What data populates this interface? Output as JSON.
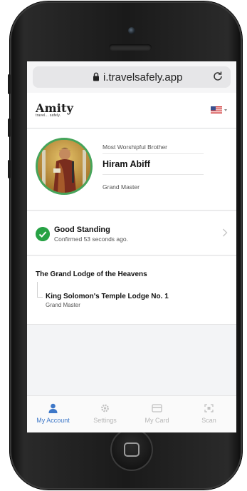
{
  "browser": {
    "url": "i.travelsafely.app"
  },
  "app": {
    "logo_text": "Amity",
    "logo_tagline": "travel... safely."
  },
  "profile": {
    "title": "Most Worshipful Brother",
    "name": "Hiram Abiff",
    "rank": "Grand Master"
  },
  "standing": {
    "status": "Good Standing",
    "confirmed": "Confirmed 53 seconds ago."
  },
  "lodge": {
    "grand_lodge": "The Grand Lodge of the Heavens",
    "subordinate_lodge": "King Solomon's Temple Lodge No. 1",
    "subordinate_rank": "Grand Master"
  },
  "tabs": [
    {
      "label": "My Account",
      "icon": "person-icon",
      "active": true
    },
    {
      "label": "Settings",
      "icon": "gear-icon",
      "active": false
    },
    {
      "label": "My Card",
      "icon": "card-icon",
      "active": false
    },
    {
      "label": "Scan",
      "icon": "scan-icon",
      "active": false
    }
  ],
  "colors": {
    "accent": "#3e78c8",
    "success": "#27a245",
    "avatar_ring": "#46a45a"
  }
}
